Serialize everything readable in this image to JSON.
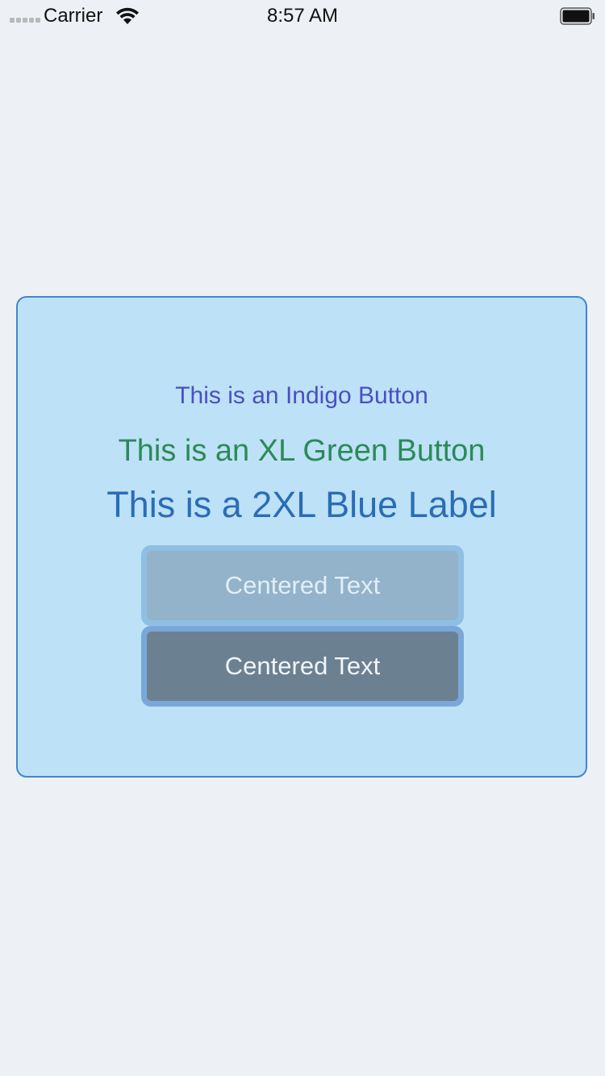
{
  "status_bar": {
    "carrier": "Carrier",
    "time": "8:57 AM",
    "icons": [
      "signal-dots-icon",
      "wifi-icon",
      "battery-icon"
    ]
  },
  "card": {
    "indigo_button": "This is an Indigo Button",
    "green_button": "This is an XL Green Button",
    "blue_label": "This is a 2XL Blue Label",
    "centered_text_light": "Centered Text",
    "centered_text_dark": "Centered Text"
  },
  "colors": {
    "background": "#edf1f5",
    "card_background": "#bde1f7",
    "card_border": "#4087cc",
    "indigo": "#4a50c2",
    "green": "#2b8a58",
    "blue": "#2a6db5",
    "centered_light_bg": "#92b3ca",
    "centered_dark_bg": "#6b8091"
  }
}
